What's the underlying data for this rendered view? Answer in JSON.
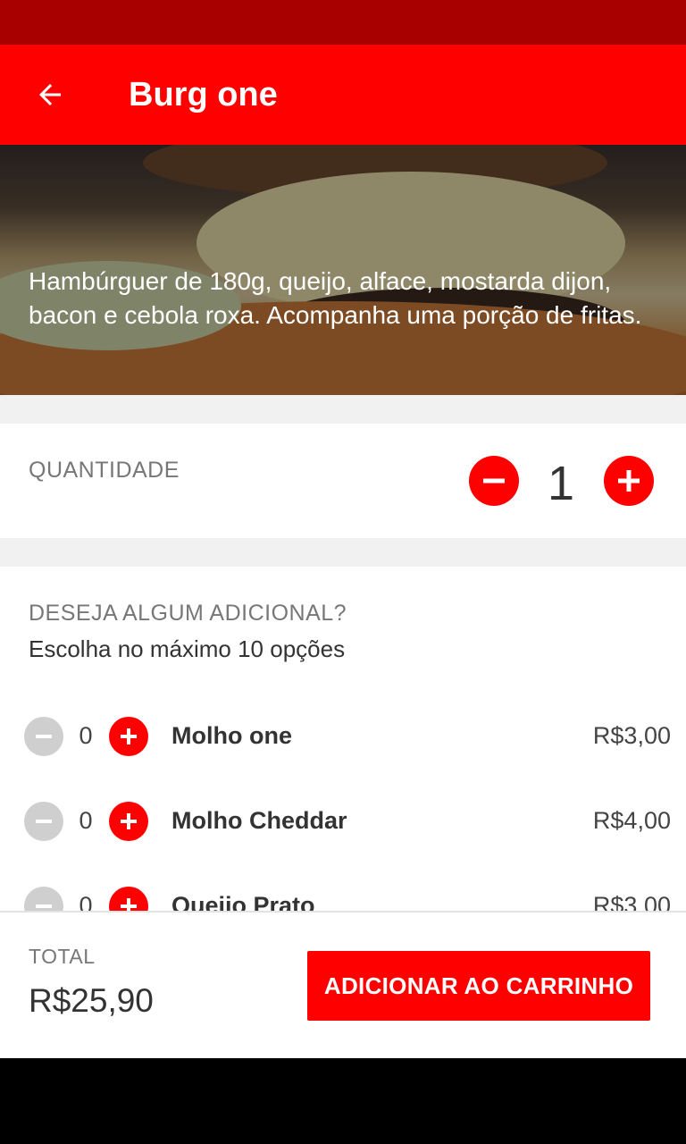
{
  "app_bar": {
    "title": "Burg one",
    "back_icon": "arrow-left-icon"
  },
  "product": {
    "description": "Hambúrguer de 180g, queijo, alface, mostarda dijon, bacon e cebola roxa. Acompanha uma porção de fritas."
  },
  "quantity": {
    "label": "QUANTIDADE",
    "value": "1"
  },
  "extras": {
    "title": "DESEJA ALGUM ADICIONAL?",
    "subtitle": "Escolha no máximo 10 opções",
    "items": [
      {
        "count": "0",
        "name": "Molho one",
        "price": "R$3,00"
      },
      {
        "count": "0",
        "name": "Molho Cheddar",
        "price": "R$4,00"
      },
      {
        "count": "0",
        "name": "Queijo Prato",
        "price": "R$3,00"
      }
    ]
  },
  "footer": {
    "total_label": "TOTAL",
    "total_value": "R$25,90",
    "cart_button": "ADICIONAR AO CARRINHO"
  },
  "colors": {
    "primary": "#ff0000",
    "status_bar": "#a80000",
    "disabled": "#cfcfcf"
  }
}
